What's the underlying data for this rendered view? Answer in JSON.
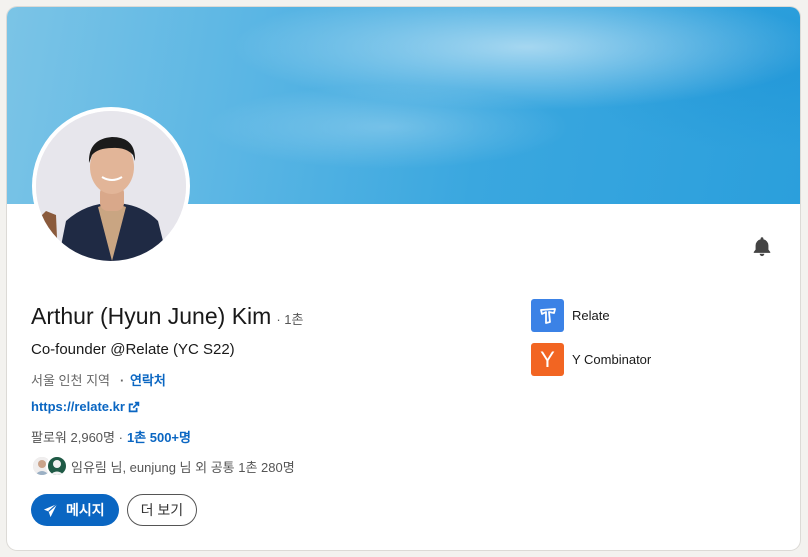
{
  "profile": {
    "name": "Arthur (Hyun June) Kim",
    "degree": "· 1촌",
    "headline": "Co-founder @Relate (YC S22)",
    "location": "서울 인천 지역",
    "contact_sep": "·",
    "contact_label": "연락처",
    "website": "https://relate.kr",
    "followers": "팔로워 2,960명 ·",
    "connections": "1촌 500+명",
    "mutual": "임유림 님, eunjung 님 외 공통 1촌 280명"
  },
  "companies": [
    {
      "label": "Relate",
      "icon": "relate-logo-icon",
      "color": "#3b82e6"
    },
    {
      "label": "Y Combinator",
      "icon": "y-combinator-logo-icon",
      "color": "#f26522",
      "letter": "Y"
    }
  ],
  "buttons": {
    "message": "메시지",
    "more": "더 보기"
  },
  "icons": {
    "bell": "bell-icon",
    "send": "send-icon",
    "external": "external-link-icon"
  },
  "colors": {
    "accent": "#0a66c2",
    "banner": "#3aa7df"
  }
}
